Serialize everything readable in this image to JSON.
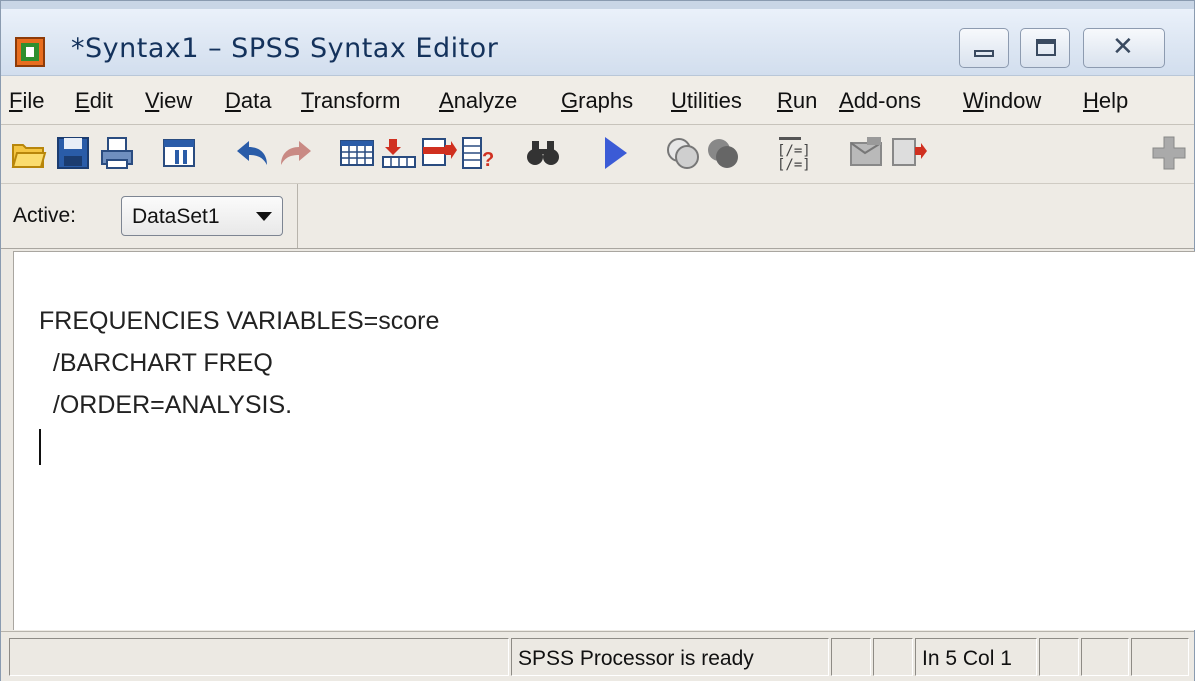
{
  "window": {
    "title": "*Syntax1 – SPSS Syntax Editor",
    "close_glyph": "✕"
  },
  "menu": [
    "File",
    "Edit",
    "View",
    "Data",
    "Transform",
    "Analyze",
    "Graphs",
    "Utilities",
    "Run",
    "Add-ons",
    "Window",
    "Help"
  ],
  "toolbar": {
    "icons": [
      "open-folder-icon",
      "save-icon",
      "print-icon",
      "dialog-recall-icon",
      "undo-icon",
      "redo-icon",
      "data-view-icon",
      "go-to-case-icon",
      "insert-case-icon",
      "variables-icon",
      "find-icon",
      "run-icon",
      "use-sets-icon",
      "show-all-variables-icon",
      "syntax-icon",
      "select-cases-icon",
      "weight-cases-icon",
      "add-icon"
    ]
  },
  "active": {
    "label": "Active:",
    "dataset": "DataSet1"
  },
  "editor": {
    "lines": [
      "FREQUENCIES VARIABLES=score",
      "  /BARCHART FREQ",
      "  /ORDER=ANALYSIS."
    ]
  },
  "status": {
    "processor": "SPSS  Processor is ready",
    "position": "In 5 Col 1"
  }
}
